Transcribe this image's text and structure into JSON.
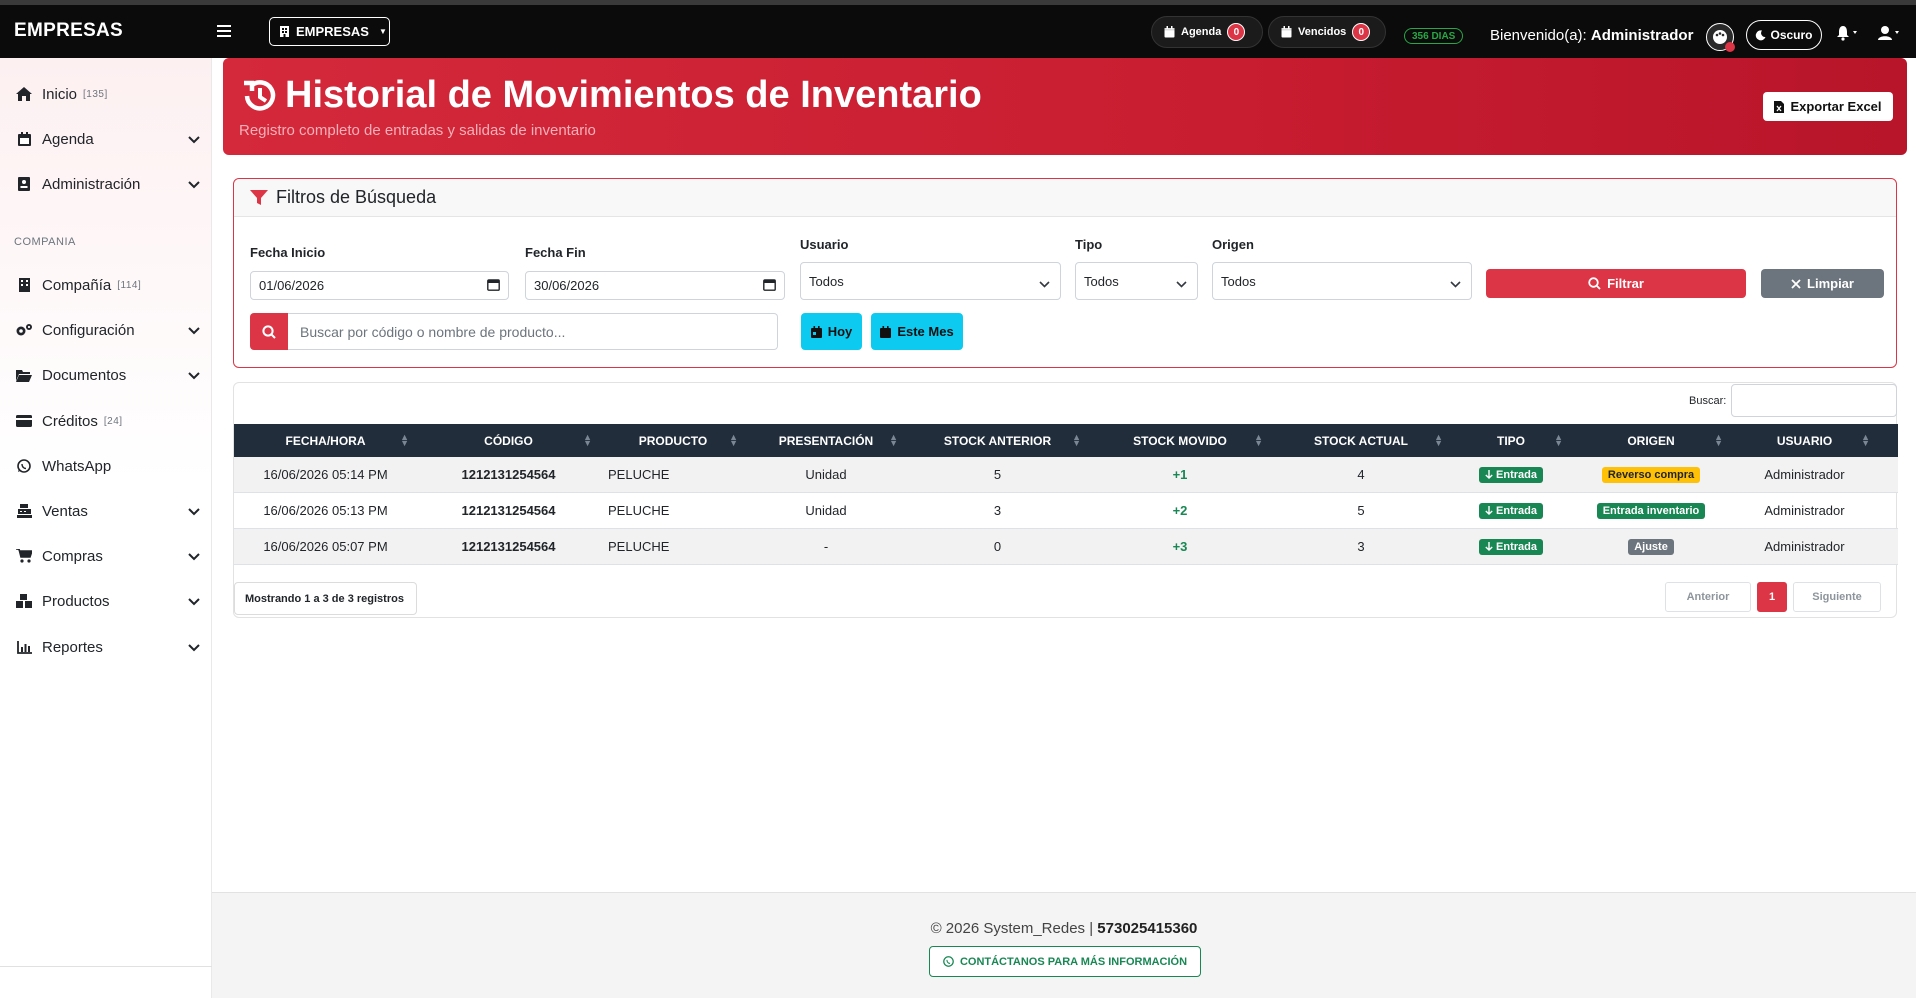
{
  "app": {
    "brand": "EMPRESAS"
  },
  "topbar": {
    "company_select": "EMPRESAS",
    "agenda_label": "Agenda",
    "agenda_count": "0",
    "vencidos_label": "Vencidos",
    "vencidos_count": "0",
    "days_badge": "356 DIAS",
    "welcome_prefix": "Bienvenido(a):",
    "welcome_user": "Administrador",
    "dark_mode_label": "Oscuro"
  },
  "sidebar": {
    "section_label": "COMPANIA",
    "items": [
      {
        "label": "Inicio",
        "badge": "[135]"
      },
      {
        "label": "Agenda"
      },
      {
        "label": "Administración"
      },
      {
        "label": "Compañía",
        "badge": "[114]"
      },
      {
        "label": "Configuración"
      },
      {
        "label": "Documentos"
      },
      {
        "label": "Créditos",
        "badge": "[24]"
      },
      {
        "label": "WhatsApp"
      },
      {
        "label": "Ventas"
      },
      {
        "label": "Compras"
      },
      {
        "label": "Productos"
      },
      {
        "label": "Reportes"
      }
    ]
  },
  "header": {
    "title": "Historial de Movimientos de Inventario",
    "subtitle": "Registro completo de entradas y salidas de inventario",
    "export_label": "Exportar Excel"
  },
  "filters": {
    "title": "Filtros de Búsqueda",
    "fecha_inicio_label": "Fecha Inicio",
    "fecha_inicio_value": "01/06/2026",
    "fecha_fin_label": "Fecha Fin",
    "fecha_fin_value": "30/06/2026",
    "usuario_label": "Usuario",
    "usuario_value": "Todos",
    "tipo_label": "Tipo",
    "tipo_value": "Todos",
    "origen_label": "Origen",
    "origen_value": "Todos",
    "filter_button": "Filtrar",
    "clear_button": "Limpiar",
    "search_placeholder": "Buscar por código o nombre de producto...",
    "today_button": "Hoy",
    "month_button": "Este Mes"
  },
  "table": {
    "search_label": "Buscar:",
    "columns": [
      "FECHA/HORA",
      "CÓDIGO",
      "PRODUCTO",
      "PRESENTACIÓN",
      "STOCK ANTERIOR",
      "STOCK MOVIDO",
      "STOCK ACTUAL",
      "TIPO",
      "ORIGEN",
      "USUARIO"
    ],
    "rows": [
      {
        "fecha": "16/06/2026 05:14 PM",
        "codigo": "1212131254564",
        "producto": "PELUCHE",
        "presentacion": "Unidad",
        "anterior": "5",
        "movido": "+1",
        "actual": "4",
        "tipo": "Entrada",
        "origen": "Reverso compra",
        "usuario": "Administrador"
      },
      {
        "fecha": "16/06/2026 05:13 PM",
        "codigo": "1212131254564",
        "producto": "PELUCHE",
        "presentacion": "Unidad",
        "anterior": "3",
        "movido": "+2",
        "actual": "5",
        "tipo": "Entrada",
        "origen": "Entrada inventario",
        "usuario": "Administrador"
      },
      {
        "fecha": "16/06/2026 05:07 PM",
        "codigo": "1212131254564",
        "producto": "PELUCHE",
        "presentacion": "-",
        "anterior": "0",
        "movido": "+3",
        "actual": "3",
        "tipo": "Entrada",
        "origen": "Ajuste",
        "usuario": "Administrador"
      }
    ],
    "info": "Mostrando 1 a 3 de 3 registros",
    "pager": {
      "prev": "Anterior",
      "current": "1",
      "next": "Siguiente"
    }
  },
  "footer": {
    "copyright": "© 2026 System_Redes |",
    "phone": "573025415360",
    "contact_button": "CONTÁCTANOS PARA MÁS INFORMACIÓN"
  },
  "colors": {
    "brand_red": "#dc3545",
    "navbar": "#0b0b0b",
    "table_header": "#212d3b",
    "success": "#198754",
    "warning": "#ffc107",
    "secondary": "#6c757d",
    "info": "#0dcaf0"
  }
}
